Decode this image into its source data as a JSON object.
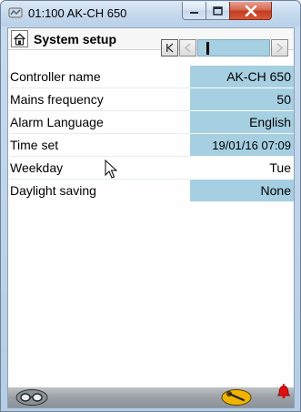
{
  "window": {
    "title": "01:100 AK-CH 650"
  },
  "header": {
    "title": "System setup"
  },
  "settings": {
    "rows": [
      {
        "label": "Controller name",
        "value": "AK-CH 650",
        "editable": true
      },
      {
        "label": "Mains frequency",
        "value": "50",
        "editable": true
      },
      {
        "label": "Alarm Language",
        "value": "English",
        "editable": true
      },
      {
        "label": "Time set",
        "value": "19/01/16 07:09",
        "editable": true
      },
      {
        "label": "Weekday",
        "value": "Tue",
        "editable": false
      },
      {
        "label": "Daylight saving",
        "value": "None",
        "editable": true
      }
    ]
  },
  "pager": {
    "current_page_fraction": 0.1
  },
  "icons": {
    "app": "controller-app-icon",
    "home": "home-icon",
    "first": "first-page-icon",
    "prev": "previous-page-icon",
    "next": "next-page-icon",
    "glasses": "glasses-icon",
    "tools": "wrench-icon",
    "alarm": "alarm-bell-icon"
  },
  "colors": {
    "value_cell": "#a6cfe1",
    "close_button": "#c33b1f",
    "alarm": "#e01010",
    "tools_button": "#f0b400"
  }
}
